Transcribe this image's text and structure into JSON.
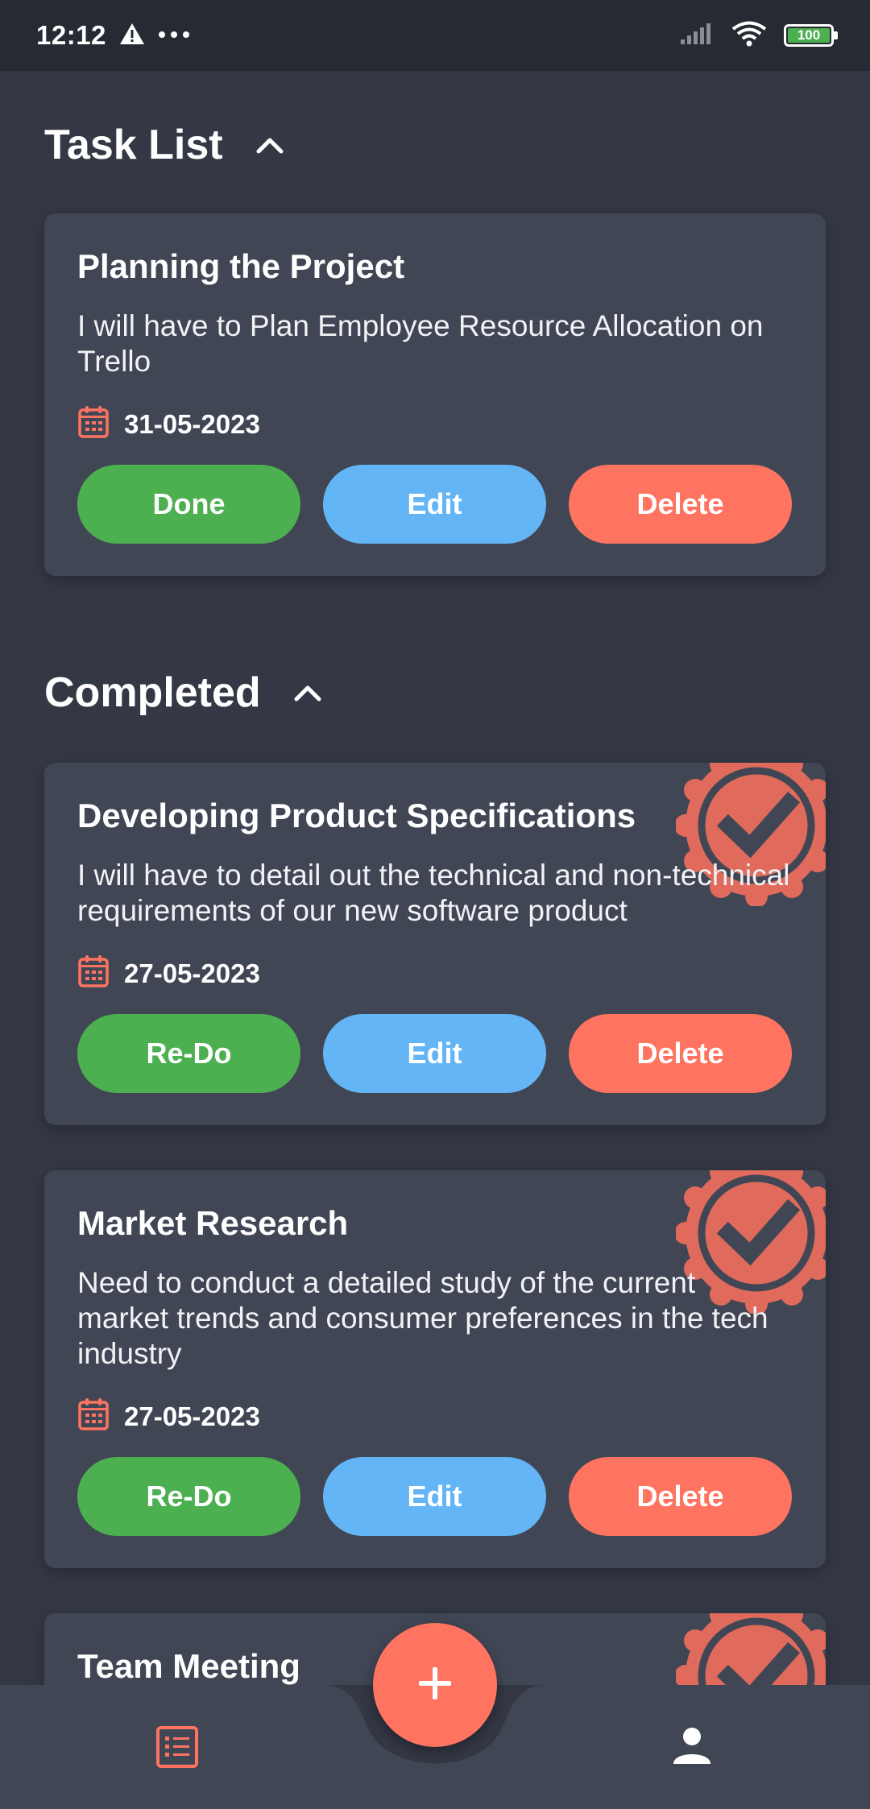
{
  "status_bar": {
    "time": "12:12",
    "battery_level": "100"
  },
  "sections": {
    "task_list": {
      "title": "Task List"
    },
    "completed": {
      "title": "Completed"
    }
  },
  "tasks": [
    {
      "title": "Planning the Project",
      "description": "I will have to Plan Employee Resource Allocation on Trello",
      "date": "31-05-2023",
      "primary_label": "Done",
      "edit_label": "Edit",
      "delete_label": "Delete"
    }
  ],
  "completed": [
    {
      "title": "Developing Product Specifications",
      "description": "I will have to detail out the technical and non-technical requirements of our new software product",
      "date": "27-05-2023",
      "primary_label": "Re-Do",
      "edit_label": "Edit",
      "delete_label": "Delete"
    },
    {
      "title": "Market Research",
      "description": "Need to conduct a detailed study of the current market trends and consumer preferences in the tech industry",
      "date": "27-05-2023",
      "primary_label": "Re-Do",
      "edit_label": "Edit",
      "delete_label": "Delete"
    },
    {
      "title": "Team Meeting"
    }
  ],
  "colors": {
    "background": "#343845",
    "card": "#414655",
    "accent": "#ff7461",
    "done_green": "#4caf50",
    "edit_blue": "#64b5f6",
    "badge": "#e06b5c"
  },
  "icons": {
    "chevron": "chevron-up-icon",
    "calendar": "calendar-icon",
    "badge": "check-seal-icon",
    "fab": "plus-icon",
    "nav_left": "task-list-icon",
    "nav_right": "profile-icon"
  }
}
